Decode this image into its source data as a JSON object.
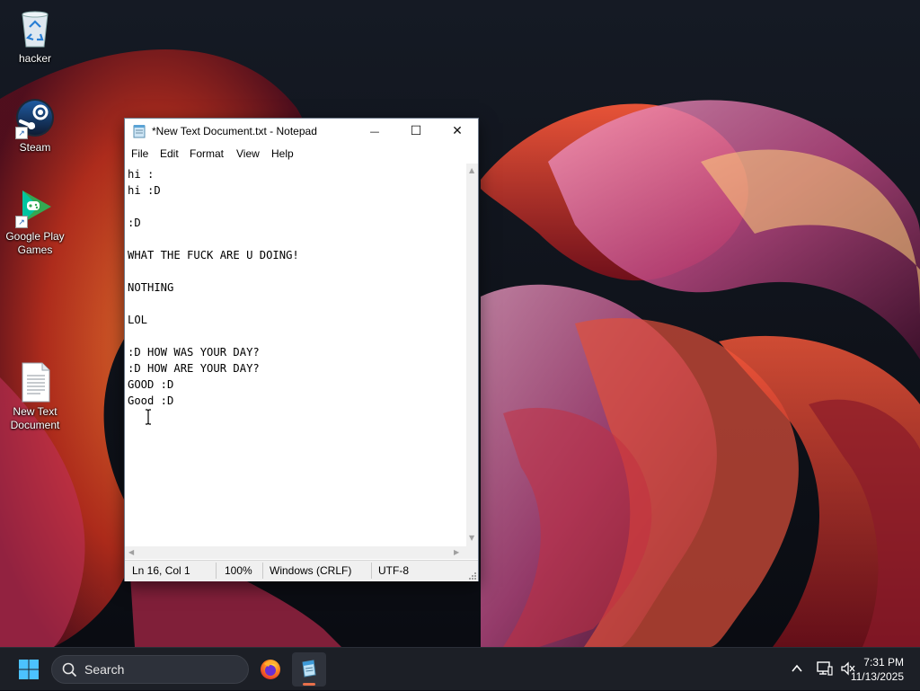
{
  "desktop": {
    "icons": [
      {
        "label": "hacker",
        "icon": "recycle-bin-icon"
      },
      {
        "label": "Steam",
        "icon": "steam-icon"
      },
      {
        "label": "Google Play Games",
        "icon": "google-play-games-icon"
      },
      {
        "label": "New Text Document",
        "icon": "text-file-icon"
      }
    ]
  },
  "notepad": {
    "title": "*New Text Document.txt - Notepad",
    "menu": [
      "File",
      "Edit",
      "Format",
      "View",
      "Help"
    ],
    "content": "hi :\nhi :D\n\n:D\n\nWHAT THE FUCK ARE U DOING!\n\nNOTHING\n\nLOL\n\n:D HOW WAS YOUR DAY?\n:D HOW ARE YOUR DAY?\nGOOD :D\nGood :D\n",
    "status": {
      "position": "Ln 16, Col 1",
      "zoom": "100%",
      "line_ending": "Windows (CRLF)",
      "encoding": "UTF-8"
    },
    "buttons": {
      "minimize": "—",
      "maximize": "☐",
      "close": "✕"
    }
  },
  "taskbar": {
    "search_label": "Search",
    "apps": [
      {
        "name": "Firefox",
        "icon": "firefox-icon"
      },
      {
        "name": "Notepad",
        "icon": "notepad-icon",
        "active": true
      }
    ],
    "tray": {
      "time": "7:31 PM",
      "date": "11/13/2025",
      "icons": [
        "chevron-up-icon",
        "network-icon",
        "volume-muted-icon"
      ]
    }
  },
  "colors": {
    "accent": "#0078d4",
    "taskbar_bg": "#1c1f26",
    "notepad_active_indicator": "#e8704a"
  }
}
